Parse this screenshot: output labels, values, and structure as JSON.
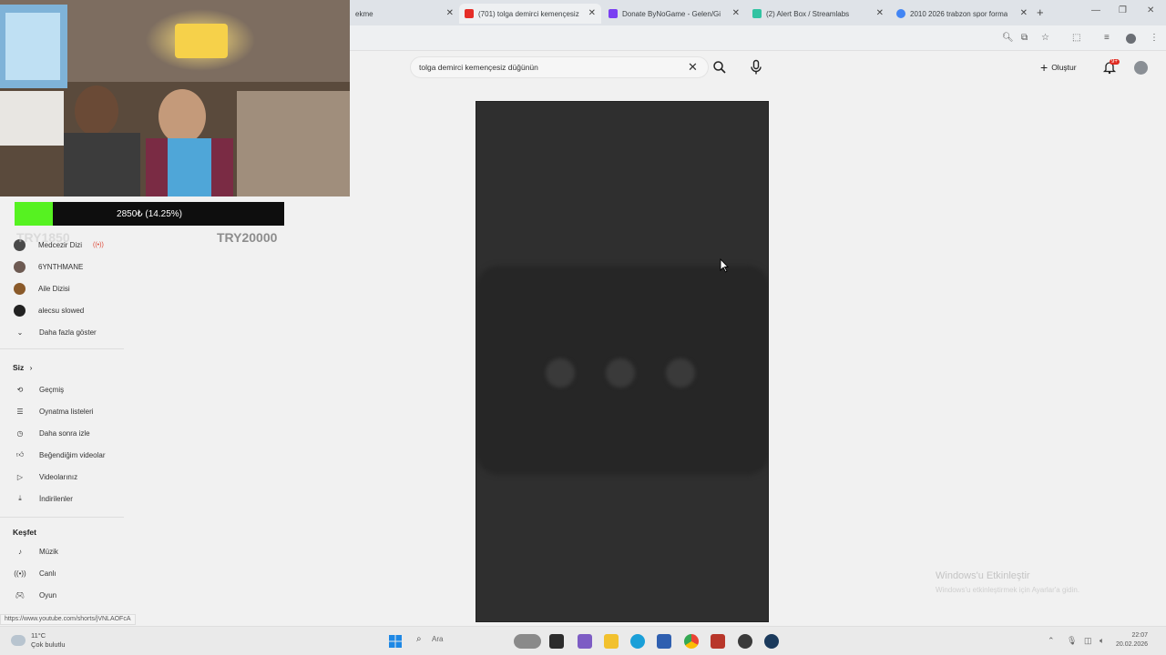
{
  "browser": {
    "tabs": [
      {
        "label": "ekme",
        "active": false,
        "favicon_color": "#dfe3e8"
      },
      {
        "label": "(701) tolga demirci kemençesiz",
        "active": true,
        "favicon_color": "#e52d27"
      },
      {
        "label": "Donate ByNoGame - Gelen/Gi",
        "active": false,
        "favicon_color": "#7a3ff2"
      },
      {
        "label": "(2) Alert Box / Streamlabs",
        "active": false,
        "favicon_color": "#31c3a2"
      },
      {
        "label": "2010 2026 trabzon spor forma",
        "active": false,
        "favicon_color": "#4285f4"
      }
    ],
    "new_tab": "+",
    "window_controls": [
      "—",
      "❐",
      "✕"
    ]
  },
  "search": {
    "query": "tolga demirci kemençesiz düğünün",
    "clear": "✕"
  },
  "header": {
    "create_label": "Oluştur",
    "notification_count": "9+"
  },
  "overlay": {
    "donation_text": "2850₺ (14.25%)",
    "progress_fraction": 0.1425,
    "goal_start": "TRY1850",
    "goal_end": "TRY20000",
    "fill_color": "#56f221"
  },
  "sidebar": {
    "subscriptions": [
      {
        "label": "Medcezir Dizi",
        "live": true,
        "color": "#4a4a4a"
      },
      {
        "label": "6YNTHMANE",
        "live": false,
        "color": "#6d5a52"
      },
      {
        "label": "Aile Dizisi",
        "live": false,
        "color": "#8a5a2a"
      },
      {
        "label": "alecsu slowed",
        "live": false,
        "color": "#222222"
      }
    ],
    "show_more": "Daha fazla göster",
    "you_title": "Siz",
    "you_items": [
      {
        "label": "Geçmiş",
        "icon": "history-icon"
      },
      {
        "label": "Oynatma listeleri",
        "icon": "playlist-icon"
      },
      {
        "label": "Daha sonra izle",
        "icon": "clock-icon"
      },
      {
        "label": "Beğendiğim videolar",
        "icon": "like-icon"
      },
      {
        "label": "Videolarınız",
        "icon": "video-icon"
      },
      {
        "label": "İndirilenler",
        "icon": "download-icon"
      }
    ],
    "explore_title": "Keşfet",
    "explore_items": [
      {
        "label": "Müzik",
        "icon": "music-icon"
      },
      {
        "label": "Canlı",
        "icon": "live-icon"
      },
      {
        "label": "Oyun",
        "icon": "gaming-icon"
      }
    ]
  },
  "status_url": "https://www.youtube.com/shorts/jVNLAOFcA",
  "watermark": {
    "title": "Windows'u Etkinleştir",
    "subtitle": "Windows'u etkinleştirmek için Ayarlar'a gidin."
  },
  "taskbar": {
    "weather_temp": "11°C",
    "weather_desc": "Çok bulutlu",
    "search_label": "Ara",
    "time": "22:07",
    "date": "20.02.2026"
  }
}
